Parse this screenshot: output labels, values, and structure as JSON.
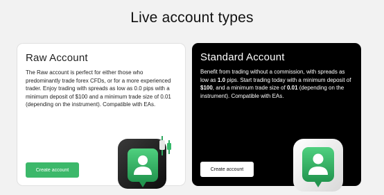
{
  "page": {
    "title": "Live account types"
  },
  "accounts": [
    {
      "name": "Raw Account",
      "description": "The Raw account is perfect for either those who predominantly trade forex CFDs, or for a more experienced trader. Enjoy trading with spreads as low as 0.0 pips with a minimum deposit of $100 and a minimum trade size of 0.01 (depending on the instrument). Compatible with EAs.",
      "button_label": "Create account",
      "icon": "trader-chart-icon"
    },
    {
      "name": "Standard Account",
      "description_parts": [
        "Benefit from trading without a commission, with spreads as low as ",
        "1.0",
        " pips. Start trading today with a minimum deposit of ",
        "$100",
        ", and a minimum trade size of ",
        "0.01",
        " (depending on the instrument). Compatible with EAs."
      ],
      "button_label": "Create account",
      "icon": "user-badge-icon"
    }
  ],
  "colors": {
    "brand_green": "#3cb86a",
    "dark_card": "#000000",
    "light_card": "#ffffff"
  }
}
